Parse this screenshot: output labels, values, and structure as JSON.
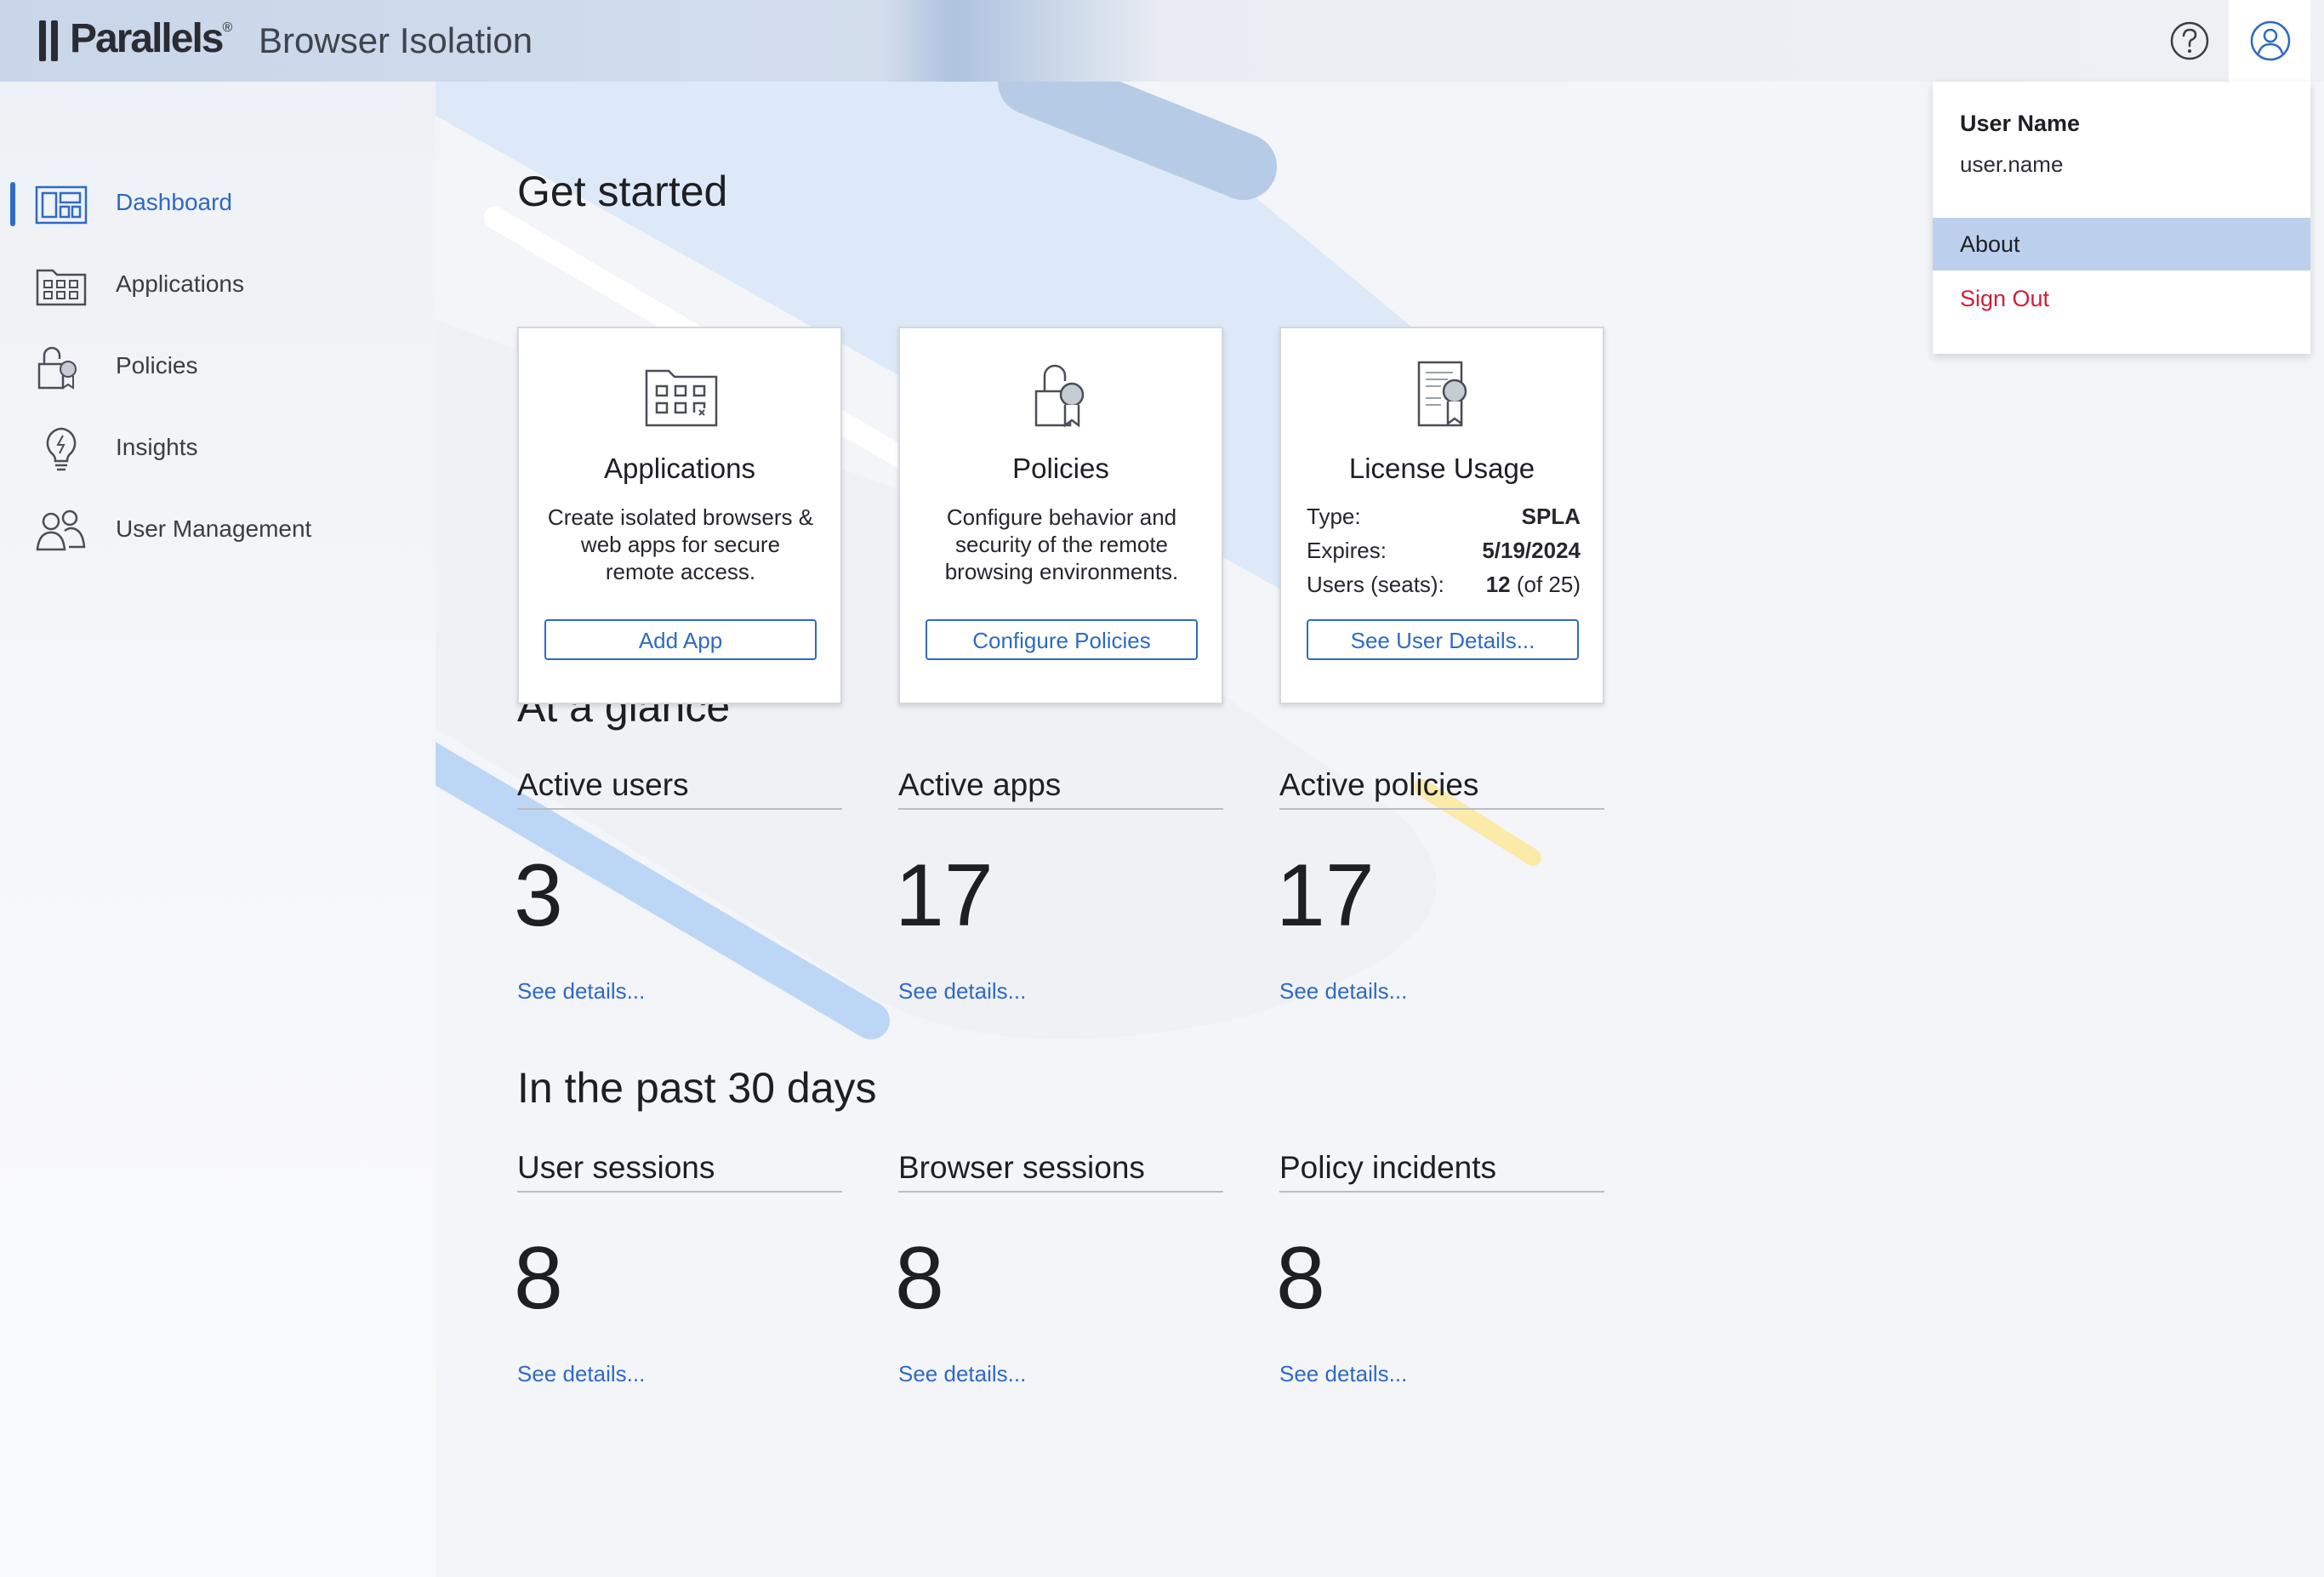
{
  "header": {
    "brand": "Parallels",
    "brand_mark": "®",
    "product": "Browser Isolation",
    "help_icon": "help-circle-icon",
    "user_icon": "user-circle-icon"
  },
  "sidebar": {
    "items": [
      {
        "label": "Dashboard",
        "icon": "dashboard-icon",
        "active": true
      },
      {
        "label": "Applications",
        "icon": "app-folder-icon",
        "active": false
      },
      {
        "label": "Policies",
        "icon": "lock-badge-icon",
        "active": false
      },
      {
        "label": "Insights",
        "icon": "lightbulb-icon",
        "active": false
      },
      {
        "label": "User Management",
        "icon": "users-icon",
        "active": false
      }
    ]
  },
  "get_started": {
    "title": "Get started",
    "cards": [
      {
        "title": "Applications",
        "description": "Create isolated browsers & web apps for secure remote access.",
        "button": "Add App",
        "icon": "app-folder-icon"
      },
      {
        "title": "Policies",
        "description": "Configure behavior and security of the remote browsing environments.",
        "button": "Configure Policies",
        "icon": "lock-badge-icon"
      },
      {
        "title": "License Usage",
        "icon": "certificate-icon",
        "rows": [
          {
            "key": "Type:",
            "value": "SPLA",
            "suffix": ""
          },
          {
            "key": "Expires:",
            "value": "5/19/2024",
            "suffix": ""
          },
          {
            "key": "Users (seats):",
            "value": "12",
            "suffix": " (of 25)"
          }
        ],
        "button": "See User Details..."
      }
    ]
  },
  "glance": {
    "title": "At a glance",
    "stats": [
      {
        "label": "Active users",
        "value": "3",
        "link": "See details..."
      },
      {
        "label": "Active apps",
        "value": "17",
        "link": "See details..."
      },
      {
        "label": "Active policies",
        "value": "17",
        "link": "See details..."
      }
    ]
  },
  "past30": {
    "title": "In the past 30 days",
    "stats": [
      {
        "label": "User sessions",
        "value": "8",
        "link": "See details..."
      },
      {
        "label": "Browser sessions",
        "value": "8",
        "link": "See details..."
      },
      {
        "label": "Policy incidents",
        "value": "8",
        "link": "See details..."
      }
    ]
  },
  "user_menu": {
    "label": "User Name",
    "username": "user.name",
    "about": "About",
    "sign_out": "Sign Out"
  },
  "colors": {
    "accent": "#2f6ac3",
    "danger": "#d01e3a",
    "menu_highlight": "#bcd0ee"
  }
}
